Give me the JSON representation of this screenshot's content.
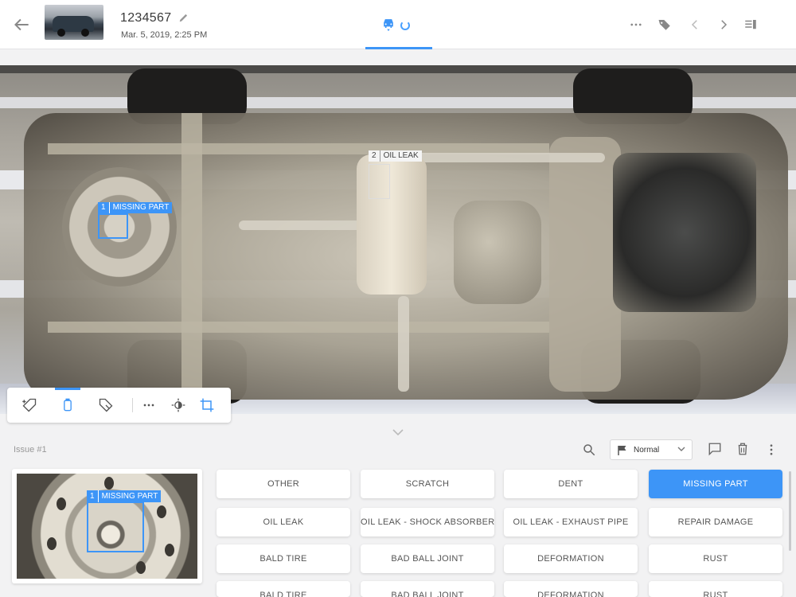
{
  "header": {
    "title": "1234567",
    "date": "Mar. 5, 2019, 2:25 PM",
    "icons": [
      "arrow-left-icon",
      "pencil-icon",
      "car-scan-icon",
      "more-icon",
      "tags-icon",
      "chevron-left-icon",
      "chevron-right-icon",
      "panel-icon"
    ]
  },
  "viewer": {
    "annotations": [
      {
        "num": "1",
        "label": "MISSING PART"
      },
      {
        "num": "2",
        "label": "OIL LEAK"
      }
    ],
    "toolbar_icons": [
      "tag-add-icon",
      "cylinder-icon",
      "tag-remove-icon",
      "more-icon",
      "brightness-icon",
      "crop-icon"
    ]
  },
  "panel": {
    "issue_label": "Issue #1",
    "priority": "Normal",
    "crop_annotation": {
      "num": "1",
      "label": "MISSING PART"
    },
    "issue_types": [
      "OTHER",
      "SCRATCH",
      "DENT",
      "MISSING PART",
      "OIL LEAK",
      "OIL LEAK - SHOCK ABSORBER",
      "OIL LEAK - EXHAUST PIPE",
      "REPAIR DAMAGE",
      "BALD TIRE",
      "BAD BALL JOINT",
      "DEFORMATION",
      "RUST",
      "BALD TIRE",
      "BAD BALL JOINT",
      "DEFORMATION",
      "RUST"
    ],
    "selected_issue": "MISSING PART"
  },
  "colors": {
    "accent": "#3d95f7",
    "background": "#f2f2f3"
  }
}
